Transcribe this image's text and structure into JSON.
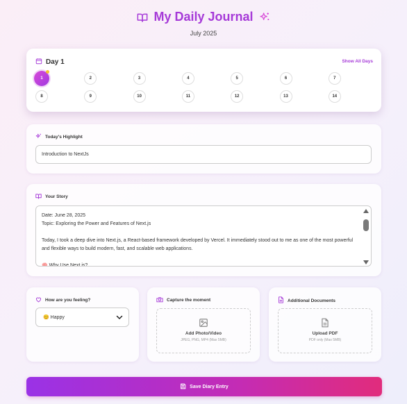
{
  "header": {
    "title": "My Daily Journal",
    "subtitle": "July 2025"
  },
  "days": {
    "current_label": "Day 1",
    "show_all_label": "Show All Days",
    "items": [
      "1",
      "2",
      "3",
      "4",
      "5",
      "6",
      "7",
      "8",
      "9",
      "10",
      "11",
      "12",
      "13",
      "14"
    ],
    "active": "1"
  },
  "highlight": {
    "label": "Today's Highlight",
    "value": "Introduction to NextJs"
  },
  "story": {
    "label": "Your Story",
    "text": "Date: June 28, 2025\nTopic: Exploring the Power and Features of Next.js\n\nToday, I took a deep dive into Next.js, a React-based framework developed by Vercel. It immediately stood out to me as one of the most powerful and flexible ways to build modern, fast, and scalable web applications.\n\n🧠 Why Use Next.js?"
  },
  "mood": {
    "label": "How are you feeling?",
    "selected": "😊 Happy"
  },
  "photo": {
    "label": "Capture the moment",
    "title": "Add Photo/Video",
    "subtitle": "JPEG, PNG, MP4 (Max 5MB)"
  },
  "documents": {
    "label": "Additional Documents",
    "title": "Upload PDF",
    "subtitle": "PDF only (Max 5MB)"
  },
  "save": {
    "label": "Save Diary Entry"
  },
  "colors": {
    "accent": "#a63ad8",
    "button_start": "#9a32e6",
    "button_end": "#e12c7c",
    "dot": "#f7c431"
  },
  "icons": {
    "title_left": "book-open-icon",
    "title_right": "sparkles-icon",
    "day": "calendar-icon",
    "highlight": "sparkles-icon",
    "story": "book-open-icon",
    "mood": "heart-icon",
    "photo": "camera-icon",
    "documents": "file-text-icon",
    "save": "save-icon"
  }
}
